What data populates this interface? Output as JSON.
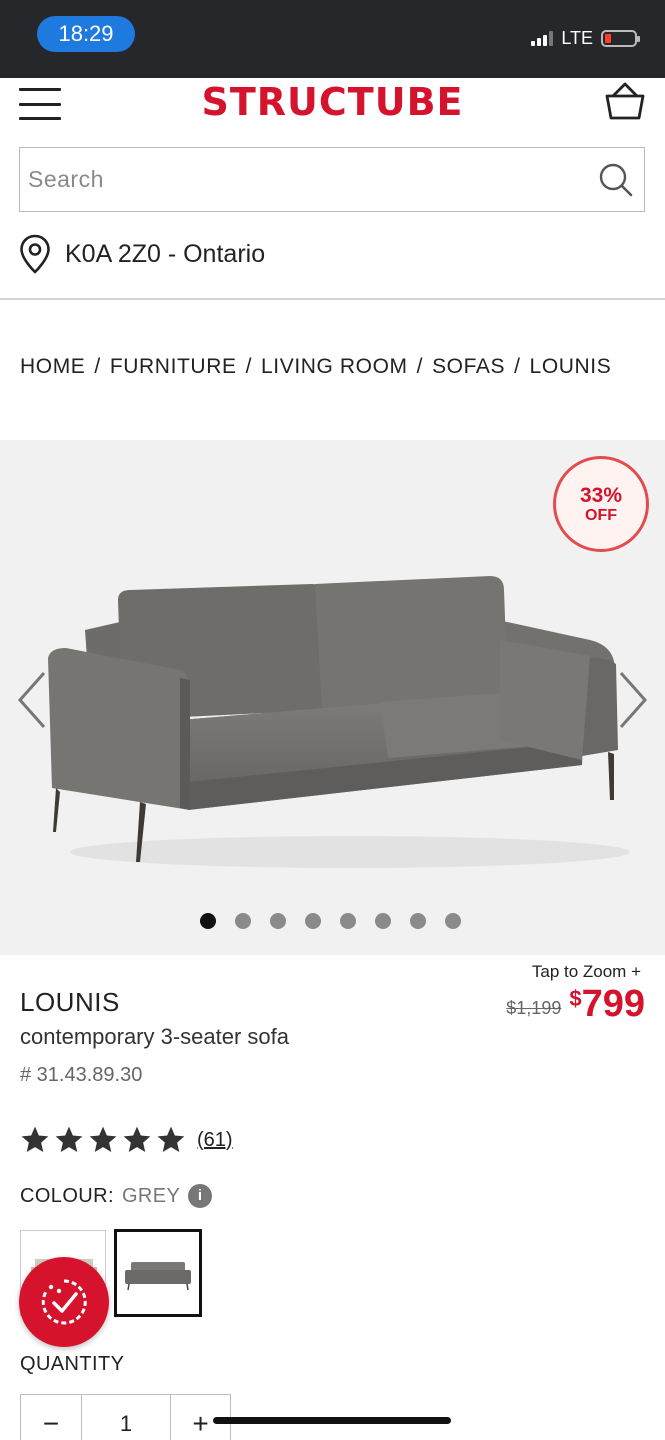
{
  "status_bar": {
    "time": "18:29",
    "network": "LTE",
    "battery_color": "#ff3b30"
  },
  "header": {
    "logo": "STRUCTUBE",
    "brand_color": "#d5132c",
    "menu_icon": "hamburger-icon",
    "cart_icon": "shopping-basket-icon"
  },
  "search": {
    "placeholder": "Search",
    "icon": "search-icon"
  },
  "location": {
    "text": "K0A 2Z0 - Ontario",
    "icon": "map-pin-icon"
  },
  "breadcrumb": [
    "HOME",
    "FURNITURE",
    "LIVING ROOM",
    "SOFAS",
    "LOUNIS"
  ],
  "gallery": {
    "badge_percent": "33%",
    "badge_label": "OFF",
    "image_count": 8,
    "active_index": 0
  },
  "product": {
    "zoom_label": "Tap to Zoom +",
    "name": "LOUNIS",
    "subtitle": "contemporary 3-seater sofa",
    "sku": "# 31.43.89.30",
    "old_price": "$1,199",
    "price_currency": "$",
    "price_amount": "799",
    "rating_value": 5,
    "review_count": "(61)",
    "colour_label": "COLOUR:",
    "colour_value": "GREY",
    "quantity_label": "QUANTITY",
    "quantity_value": "1",
    "minus_label": "−",
    "plus_label": "+"
  }
}
